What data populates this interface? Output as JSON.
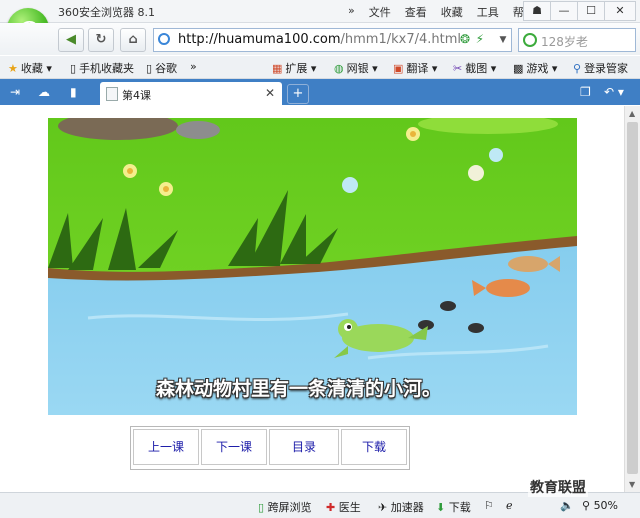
{
  "window": {
    "title": "360安全浏览器 8.1",
    "menu": [
      "文件",
      "查看",
      "收藏",
      "工具",
      "帮助"
    ],
    "controls": [
      "☗",
      "—",
      "☐",
      "✕"
    ]
  },
  "nav": {
    "back": "◀",
    "refresh": "↻",
    "home": "⌂",
    "url_host": "http://huamuma100.com",
    "url_path": "/hmm1/kx7/4.html",
    "search_placeholder": "128岁老"
  },
  "favbar": {
    "items": [
      "收藏",
      "手机收藏夹",
      "谷歌"
    ],
    "more": "»",
    "tools": [
      "扩展",
      "网银",
      "翻译",
      "截图",
      "游戏",
      "登录管家"
    ]
  },
  "tabs": {
    "active": "第4课",
    "close": "✕",
    "new": "+"
  },
  "page": {
    "caption": "森林动物村里有一条清清的小河。",
    "nav_buttons": [
      "上一课",
      "下一课",
      "目录",
      "下载"
    ]
  },
  "status": {
    "items": [
      "跨屏浏览",
      "医生",
      "加速器",
      "下载"
    ],
    "zoom": "50%"
  },
  "watermark": "教育联盟",
  "colors": {
    "tabbar": "#3f7fc5",
    "grass": "#6fd11e",
    "water": "#8fd0ef",
    "bank": "#8a5a2b",
    "link": "#1a1aa8"
  }
}
